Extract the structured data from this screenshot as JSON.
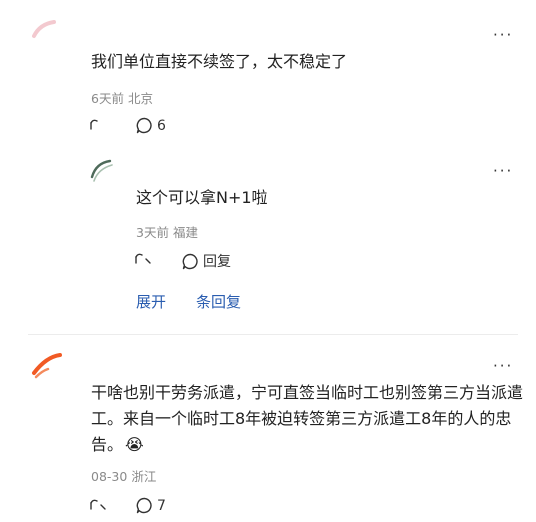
{
  "comments": [
    {
      "text": "我们单位直接不续签了，太不稳定了",
      "time": "6天前",
      "location": "北京",
      "comment_count": "6",
      "more_label": "···"
    },
    {
      "text": "这个可以拿N+1啦",
      "time": "3天前",
      "location": "福建",
      "reply_label": "回复",
      "more_label": "···"
    },
    {
      "text": "干啥也别干劳务派遣，宁可直签当临时工也别签第三方当派遣工。来自一个临时工8年被迫转签第三方派遣工8年的人的忠告。",
      "emoji": "😭",
      "time": "08-30",
      "location": "浙江",
      "comment_count": "7",
      "more_label": "···"
    }
  ],
  "expand_replies": {
    "label_start": "展开",
    "label_end": "条回复"
  }
}
